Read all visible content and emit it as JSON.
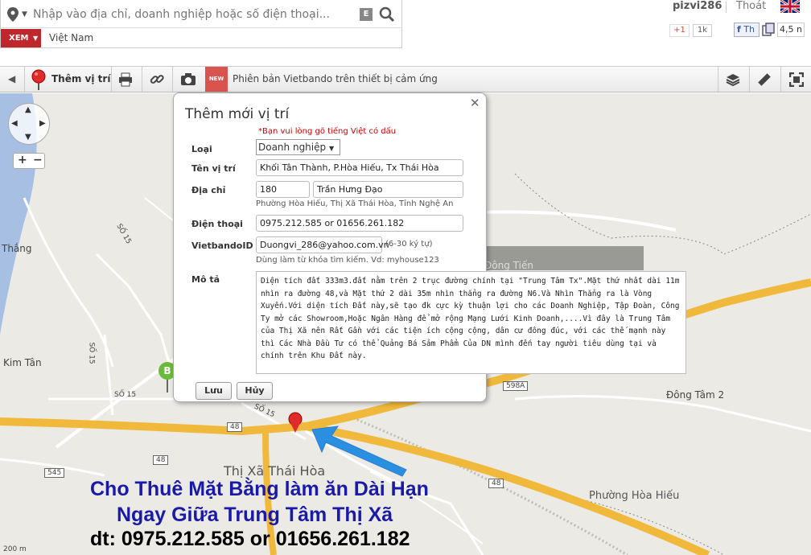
{
  "header": {
    "search_placeholder": "Nhập vào địa chỉ, doanh nghiệp hoặc số điện thoại...",
    "e_label": "E",
    "xem_label": "XEM",
    "country": "Việt Nam",
    "user": "pizvi286",
    "logout": "Thoát",
    "gplus": "+1",
    "gplus_count": "1k",
    "fb_label": "Th",
    "zoom": "4,5 n"
  },
  "toolbar": {
    "add_location": "Thêm vị trí",
    "new_badge": "NEW",
    "version_text": "Phiên bản Vietbando trên thiết bị cảm ứng"
  },
  "map": {
    "labels": {
      "thang": "Thắng",
      "kim_tan": "Kim Tân",
      "so15_a": "SỐ 15",
      "so15_b": "SỐ 15",
      "so15_c": "SỐ 15",
      "so15_d": "SỐ 15",
      "dong_tien": "Đông Tiến",
      "dong_tam": "Đông Tâm 2",
      "thi_xa": "Thị Xã Thái Hòa",
      "phuong_hoa_hieu": "Phường Hòa Hiếu",
      "road48_a": "48",
      "road48_b": "48",
      "road48_c": "48",
      "road545": "545",
      "road598": "598A",
      "marker_b": "B",
      "scale": "200 m"
    }
  },
  "popup": {
    "title": "Thêm mới vị trí",
    "note": "*Bạn vui lòng gõ tiếng Việt có dấu",
    "type_label": "Loại",
    "type_value": "Doanh nghiệp",
    "name_label": "Tên vị trí",
    "name_value": "Khối Tân Thành, P.Hòa Hiếu, Tx Thái Hòa",
    "address_label": "Địa chỉ",
    "house_no": "180",
    "street": "Trần Hưng Đạo",
    "ward_line": "Phường Hòa Hiếu, Thị Xã Thái Hòa, Tỉnh Nghệ An",
    "phone_label": "Điện thoại",
    "phone_value": "0975.212.585 or 01656.261.182",
    "vbid_label": "VietbandoID",
    "vbid_value": "Duongvi_286@yahoo.com.vn",
    "vbid_hint": "(6-30 ký tự)",
    "vbid_sub": "Dùng làm từ khóa tìm kiếm. Vd: myhouse123",
    "desc_label": "Mô tả",
    "desc_value": "Diện tích đất 333m3.đất nằm trên 2 trục đường chính tại \"Trung Tâm Tx\".Mặt thứ nhất dài 11m nhìn ra đường 48,và Mặt thứ 2 dài 35m nhìn thẳng ra đường N6.Và Nhìn Thẳng ra là Vòng Xuyến.Với diện tích Đất này,sẽ tạo đk cực kỳ thuận lợi cho các Doanh Nghiệp, Tập Đoàn, Công Ty mở các Showroom,Hoặc Ngân Hàng để mở rộng Mạng Lưới Kinh Doanh,....Vì đây là Trung Tâm của Thị Xã nên Rất Gần với các tiện ích cộng cộng, dân cư đông đúc, với các thế mạnh này thì Các Nhà Đầu Tư có thể Quảng Bá Sảm Phẩm Của DN mình đến tay người tiêu dùng tại và chính trên Khu Đất này.",
    "save": "Lưu",
    "cancel": "Hủy"
  },
  "overlay": {
    "line1": "Cho Thuê Mặt Bằng làm ăn Dài Hạn",
    "line2": "Ngay Giữa Trung Tâm Thị Xã",
    "line3": "dt: 0975.212.585 or 01656.261.182"
  }
}
